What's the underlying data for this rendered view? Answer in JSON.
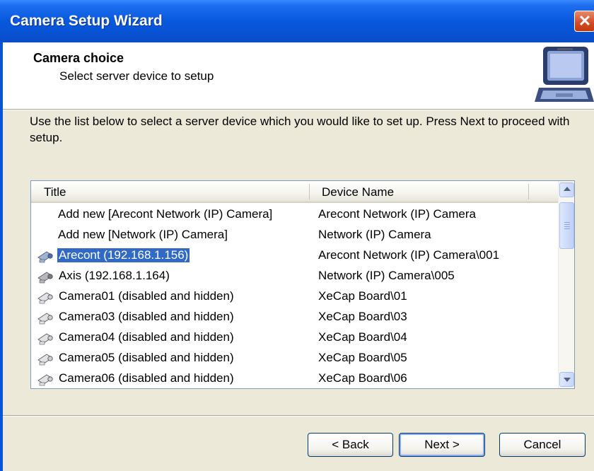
{
  "window": {
    "title": "Camera Setup Wizard",
    "close_glyph": "✕"
  },
  "header": {
    "title": "Camera choice",
    "subtitle": "Select server device to setup",
    "icon": "laptop-icon"
  },
  "instructions": "Use the list below to select a server device which you would like to set up. Press Next to proceed with setup.",
  "list": {
    "columns": [
      "Title",
      "Device Name"
    ],
    "rows": [
      {
        "title": "Add new [Arecont Network (IP) Camera]",
        "device": "Arecont Network (IP) Camera",
        "icon": "none",
        "selected": false
      },
      {
        "title": "Add new [Network (IP) Camera]",
        "device": "Network (IP) Camera",
        "icon": "none",
        "selected": false
      },
      {
        "title": "Arecont (192.168.1.156)",
        "device": "Arecont Network (IP) Camera\\001",
        "icon": "camera-active-icon",
        "selected": true
      },
      {
        "title": "Axis (192.168.1.164)",
        "device": "Network (IP) Camera\\005",
        "icon": "camera-icon",
        "selected": false
      },
      {
        "title": "Camera01 (disabled and hidden)",
        "device": "XeCap Board\\01",
        "icon": "camera-disabled-icon",
        "selected": false
      },
      {
        "title": "Camera03 (disabled and hidden)",
        "device": "XeCap Board\\03",
        "icon": "camera-disabled-icon",
        "selected": false
      },
      {
        "title": "Camera04 (disabled and hidden)",
        "device": "XeCap Board\\04",
        "icon": "camera-disabled-icon",
        "selected": false
      },
      {
        "title": "Camera05 (disabled and hidden)",
        "device": "XeCap Board\\05",
        "icon": "camera-disabled-icon",
        "selected": false
      },
      {
        "title": "Camera06 (disabled and hidden)",
        "device": "XeCap Board\\06",
        "icon": "camera-disabled-icon",
        "selected": false
      }
    ]
  },
  "buttons": {
    "back": "< Back",
    "next": "Next >",
    "cancel": "Cancel"
  },
  "colors": {
    "titlebar": "#0754d6",
    "selection": "#316ac5",
    "dialog_bg": "#ece9d8"
  }
}
